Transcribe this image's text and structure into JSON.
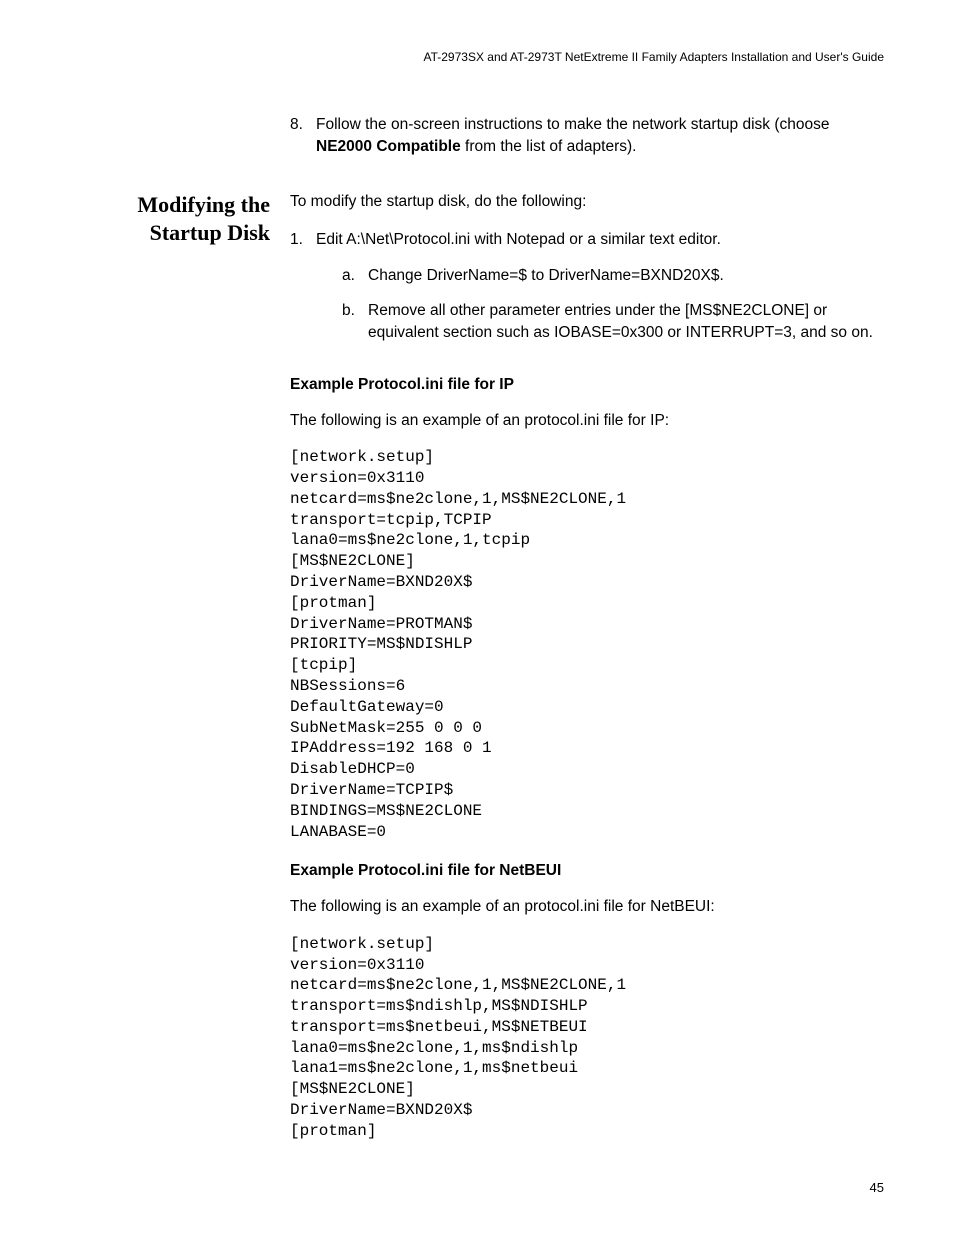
{
  "header": {
    "running_title": "AT-2973SX and AT-2973T NetExtreme II Family Adapters Installation and User's Guide"
  },
  "step8": {
    "num": "8.",
    "text_before": "Follow the on-screen instructions to make the network startup disk (choose ",
    "bold": "NE2000 Compatible",
    "text_after": " from the list of adapters)."
  },
  "side_heading": {
    "line1": "Modifying the",
    "line2": "Startup Disk"
  },
  "intro": "To modify the startup disk, do the following:",
  "step1": {
    "num": "1.",
    "text": "Edit A:\\Net\\Protocol.ini with Notepad or a similar text editor."
  },
  "step1a": {
    "num": "a.",
    "text": "Change DriverName=$ to DriverName=BXND20X$."
  },
  "step1b": {
    "num": "b.",
    "text": "Remove all other parameter entries under the [MS$NE2CLONE] or equivalent section such as IOBASE=0x300 or INTERRUPT=3, and so on."
  },
  "example_ip": {
    "heading": "Example Protocol.ini file for IP",
    "intro": "The following is an example of an protocol.ini file for IP:",
    "code": "[network.setup]\nversion=0x3110\nnetcard=ms$ne2clone,1,MS$NE2CLONE,1\ntransport=tcpip,TCPIP\nlana0=ms$ne2clone,1,tcpip\n[MS$NE2CLONE]\nDriverName=BXND20X$\n[protman]\nDriverName=PROTMAN$\nPRIORITY=MS$NDISHLP\n[tcpip]\nNBSessions=6\nDefaultGateway=0\nSubNetMask=255 0 0 0\nIPAddress=192 168 0 1\nDisableDHCP=0\nDriverName=TCPIP$\nBINDINGS=MS$NE2CLONE\nLANABASE=0"
  },
  "example_netbeui": {
    "heading": "Example Protocol.ini file for NetBEUI",
    "intro": "The following is an example of an protocol.ini file for NetBEUI:",
    "code": "[network.setup]\nversion=0x3110\nnetcard=ms$ne2clone,1,MS$NE2CLONE,1\ntransport=ms$ndishlp,MS$NDISHLP\ntransport=ms$netbeui,MS$NETBEUI\nlana0=ms$ne2clone,1,ms$ndishlp\nlana1=ms$ne2clone,1,ms$netbeui\n[MS$NE2CLONE]\nDriverName=BXND20X$\n[protman]"
  },
  "page_number": "45"
}
